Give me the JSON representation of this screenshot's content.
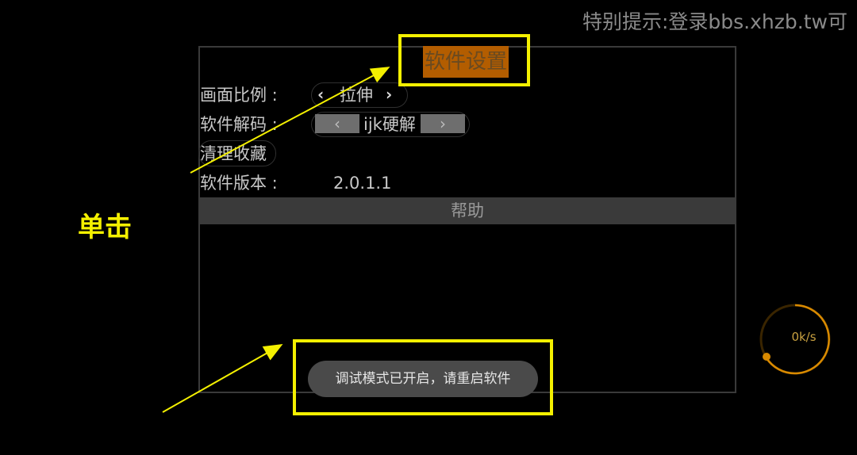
{
  "marquee_text": "特别提示:登录bbs.xhzb.tw可",
  "settings": {
    "title": "软件设置",
    "aspect_ratio": {
      "label": "画面比例 :",
      "value": "拉伸"
    },
    "decoder": {
      "label": "软件解码 :",
      "value": "ijk硬解"
    },
    "clear_favorites": {
      "label": "清理收藏"
    },
    "version": {
      "label": "软件版本 :",
      "value": "2.0.1.1"
    },
    "help": {
      "label": "帮助"
    }
  },
  "toast": {
    "text": "调试模式已开启，请重启软件"
  },
  "annotation": {
    "text": "单击"
  },
  "speed": {
    "value": "0k/s"
  },
  "colors": {
    "highlight": "#f4f000",
    "title_bg": "#b35d00",
    "speed_ring": "#d98a00"
  }
}
